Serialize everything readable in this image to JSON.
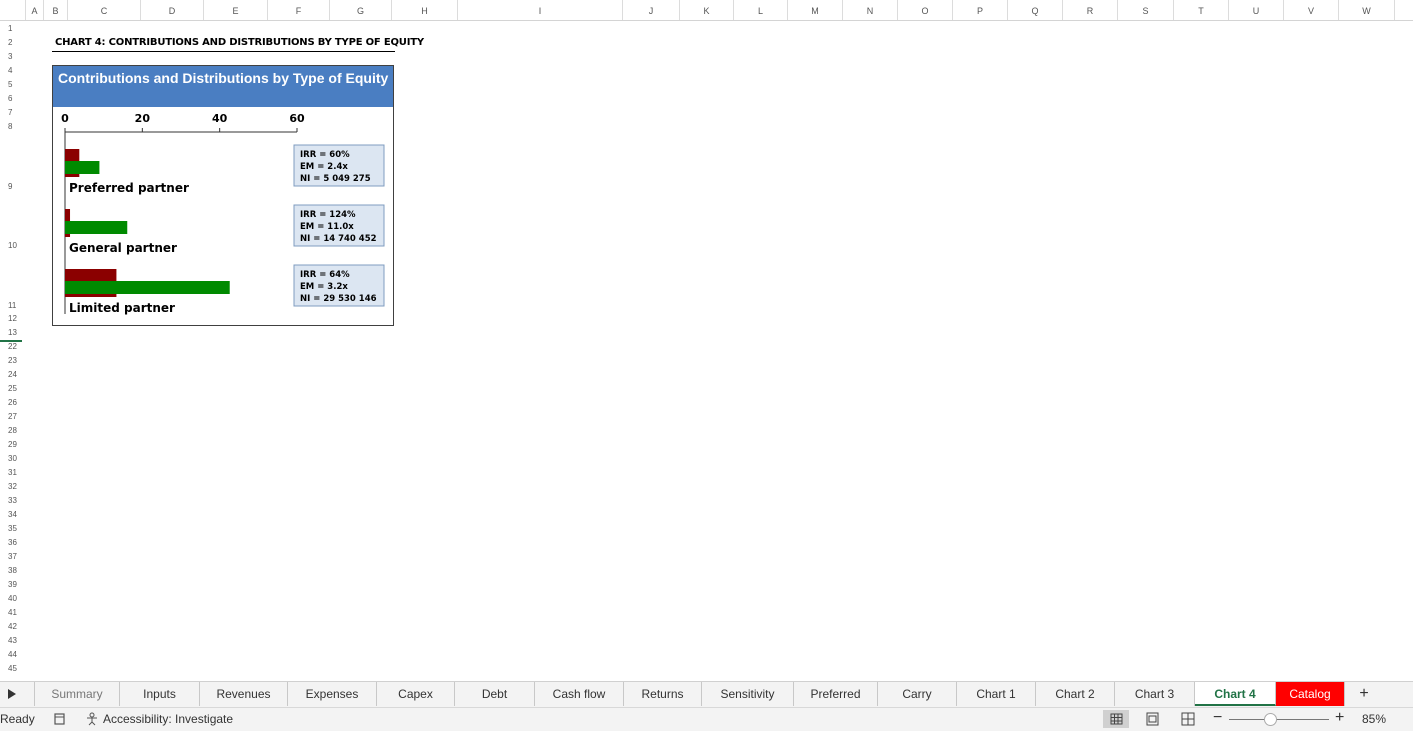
{
  "columns": [
    "A",
    "B",
    "C",
    "D",
    "E",
    "F",
    "G",
    "H",
    "I",
    "J",
    "K",
    "L",
    "M",
    "N",
    "O",
    "P",
    "Q",
    "R",
    "S",
    "T",
    "U",
    "V",
    "W"
  ],
  "rows": [
    "1",
    "2",
    "3",
    "4",
    "5",
    "6",
    "7",
    "8",
    "9",
    "10",
    "11",
    "12",
    "13",
    "22",
    "23",
    "24",
    "25",
    "26",
    "27",
    "28",
    "29",
    "30",
    "31",
    "32",
    "33",
    "34",
    "35",
    "36",
    "37",
    "38",
    "39",
    "40",
    "41",
    "42",
    "43",
    "44",
    "45"
  ],
  "sheet_title": "CHART 4: CONTRIBUTIONS AND DISTRIBUTIONS BY TYPE OF EQUITY",
  "chart_data": {
    "type": "bar",
    "orientation": "horizontal",
    "title": "Contributions and Distributions by Type of Equity",
    "categories": [
      "Preferred partner",
      "General partner",
      "Limited partner"
    ],
    "series": [
      {
        "color": "#8b0000",
        "values": [
          3.7,
          1.3,
          13.3
        ]
      },
      {
        "color": "#008a00",
        "values": [
          8.9,
          16.1,
          42.6
        ]
      }
    ],
    "x_ticks": [
      "0",
      "20",
      "40",
      "60"
    ],
    "xlim": [
      0,
      60
    ],
    "annotations": [
      {
        "irr": "IRR = 60%",
        "em": "EM = 2.4x",
        "ni": "NI = 5 049 275"
      },
      {
        "irr": "IRR = 124%",
        "em": "EM = 11.0x",
        "ni": "NI = 14 740 452"
      },
      {
        "irr": "IRR = 64%",
        "em": "EM = 3.2x",
        "ni": "NI = 29 530 146"
      }
    ]
  },
  "tabs": [
    "Summary",
    "Inputs",
    "Revenues",
    "Expenses",
    "Capex",
    "Debt",
    "Cash flow",
    "Returns",
    "Sensitivity",
    "Preferred",
    "Carry",
    "Chart 1",
    "Chart 2",
    "Chart 3",
    "Chart 4",
    "Catalog"
  ],
  "active_tab": "Chart 4",
  "status": {
    "ready": "Ready",
    "accessibility": "Accessibility: Investigate",
    "zoom": "85%"
  },
  "colors": {
    "accent": "#217346",
    "chart_header": "#4a7ec2",
    "catalog_tab": "#ff0000"
  }
}
